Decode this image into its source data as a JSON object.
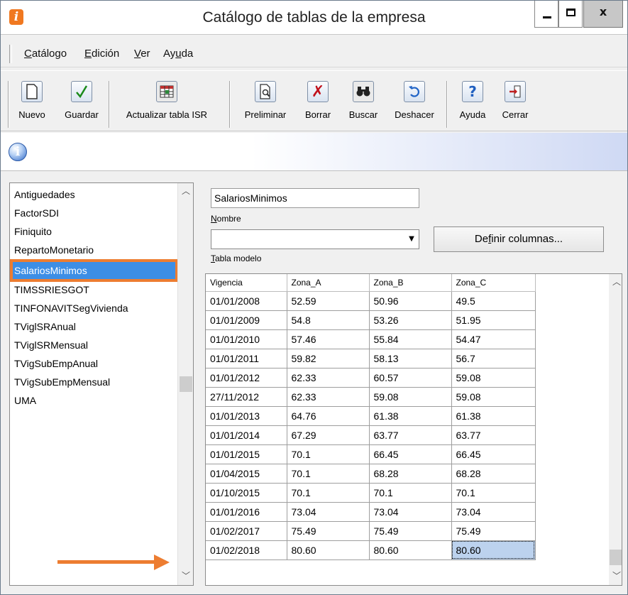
{
  "window": {
    "title": "Catálogo de tablas de la empresa",
    "app_icon_letter": "i",
    "controls": {
      "minimize": "minimize",
      "maximize": "maximize",
      "close": "x"
    }
  },
  "menu": [
    {
      "key": "C",
      "rest": "atálogo"
    },
    {
      "key": "E",
      "rest": "dición"
    },
    {
      "key": "V",
      "rest": "er"
    },
    {
      "pre": "Ay",
      "key": "u",
      "rest": "da"
    }
  ],
  "toolbar": {
    "nuevo": "Nuevo",
    "guardar": "Guardar",
    "actualizar": "Actualizar tabla ISR",
    "preliminar": "Preliminar",
    "borrar": "Borrar",
    "buscar": "Buscar",
    "deshacer": "Deshacer",
    "ayuda": "Ayuda",
    "cerrar": "Cerrar"
  },
  "colors": {
    "accent": "#3d8ee5",
    "annotation": "#ed7d31",
    "selected_cell": "#bcd2ee"
  },
  "list": {
    "items": [
      "Antiguedades",
      "FactorSDI",
      "Finiquito",
      "RepartoMonetario",
      "SalariosMinimos",
      "TIMSSRIESGOT",
      "TINFONAVITSegVivienda",
      "TViglSRAnual",
      "TViglSRMensual",
      "TVigSubEmpAnual",
      "TVigSubEmpMensual",
      "UMA"
    ],
    "selected": "SalariosMinimos"
  },
  "form": {
    "name_value": "SalariosMinimos",
    "name_caption_key": "N",
    "name_caption_rest": "ombre",
    "model_value": "",
    "model_caption_key": "T",
    "model_caption_rest": "abla modelo",
    "define_pre": "De",
    "define_key": "f",
    "define_rest": "inir columnas..."
  },
  "grid": {
    "headers": [
      "Vigencia",
      "Zona_A",
      "Zona_B",
      "Zona_C"
    ],
    "rows": [
      [
        "01/01/2008",
        "52.59",
        "50.96",
        "49.5"
      ],
      [
        "01/01/2009",
        "54.8",
        "53.26",
        "51.95"
      ],
      [
        "01/01/2010",
        "57.46",
        "55.84",
        "54.47"
      ],
      [
        "01/01/2011",
        "59.82",
        "58.13",
        "56.7"
      ],
      [
        "01/01/2012",
        "62.33",
        "60.57",
        "59.08"
      ],
      [
        "27/11/2012",
        "62.33",
        "59.08",
        "59.08"
      ],
      [
        "01/01/2013",
        "64.76",
        "61.38",
        "61.38"
      ],
      [
        "01/01/2014",
        "67.29",
        "63.77",
        "63.77"
      ],
      [
        "01/01/2015",
        "70.1",
        "66.45",
        "66.45"
      ],
      [
        "01/04/2015",
        "70.1",
        "68.28",
        "68.28"
      ],
      [
        "01/10/2015",
        "70.1",
        "70.1",
        "70.1"
      ],
      [
        "01/01/2016",
        "73.04",
        "73.04",
        "73.04"
      ],
      [
        "01/02/2017",
        "75.49",
        "75.49",
        "75.49"
      ],
      [
        "01/02/2018",
        "80.60",
        "80.60",
        "80.60"
      ]
    ]
  }
}
